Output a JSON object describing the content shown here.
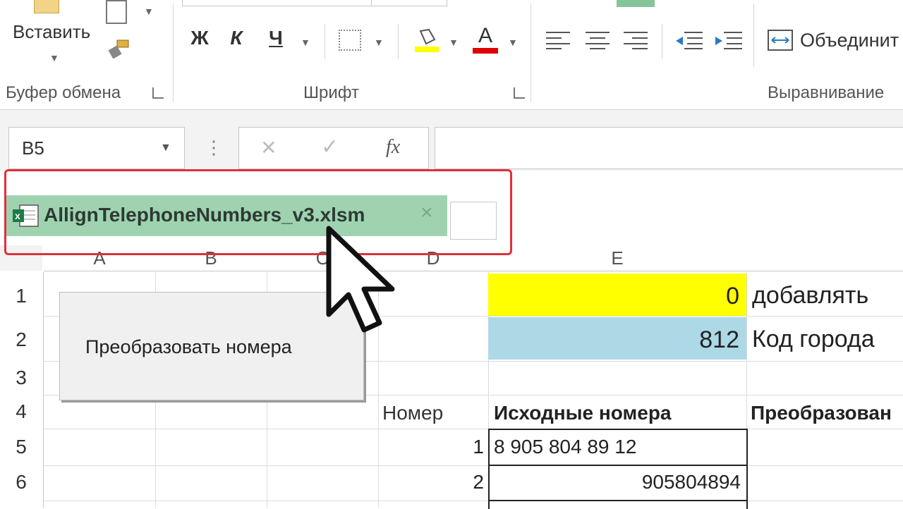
{
  "ribbon": {
    "clipboard": {
      "paste_label": "Вставить",
      "group_label": "Буфер обмена"
    },
    "font": {
      "bold": "Ж",
      "italic": "К",
      "underline": "Ч",
      "group_label": "Шрифт",
      "fill_color": "#ffff00",
      "font_color": "#e00000"
    },
    "alignment": {
      "merge_label": "Объединит",
      "group_label": "Выравнивание"
    }
  },
  "formula_bar": {
    "name_box": "B5",
    "more_icon": "⋮",
    "cancel_icon": "✕",
    "enter_icon": "✓",
    "fx_label": "fx",
    "formula": ""
  },
  "file_tab": {
    "name": "AllignTelephoneNumbers_v3.xlsm",
    "close": "×"
  },
  "sheet": {
    "columns": [
      "A",
      "B",
      "C",
      "D",
      "E"
    ],
    "rows": [
      "1",
      "2",
      "3",
      "4",
      "5",
      "6"
    ],
    "button_label": "Преобразовать номера",
    "cells": {
      "E1": "0",
      "F1": "добавлять",
      "E2": "812",
      "F2": "Код города",
      "D4": "Номер",
      "E4": "Исходные номера",
      "F4": "Преобразован",
      "D5": "1",
      "E5": "8 905 804 89 12",
      "D6": "2",
      "E6": "905804894"
    },
    "colors": {
      "yellow": "#ffff00",
      "light_blue": "#add8e6",
      "tab_green": "#9fd3b0",
      "annotation_red": "#e0303a"
    }
  }
}
